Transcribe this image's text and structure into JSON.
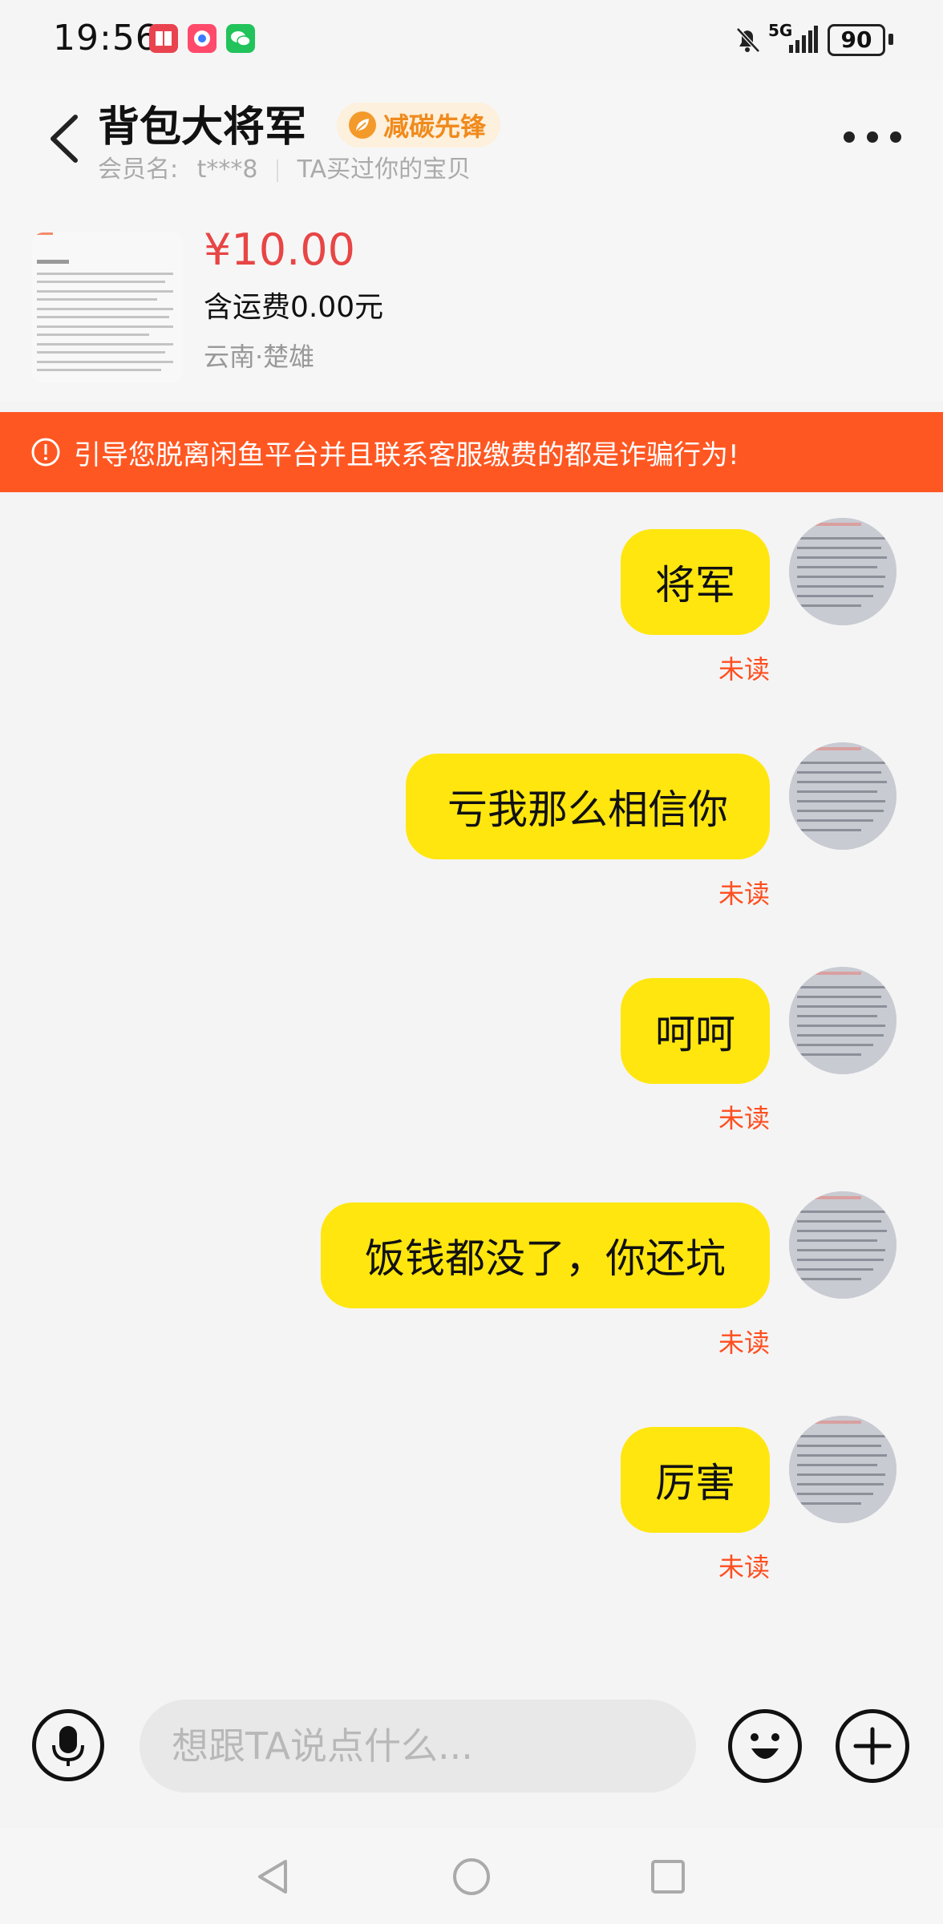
{
  "status_bar": {
    "time": "19:56",
    "network": "5G",
    "battery": "90",
    "icons": [
      "book-app-icon",
      "game-app-icon",
      "wechat-icon",
      "mute-bell-icon",
      "signal-icon",
      "battery-icon"
    ]
  },
  "header": {
    "title": "背包大将军",
    "badge": "减碳先锋",
    "member_label": "会员名:",
    "member_name": "t***8",
    "purchase_note": "TA买过你的宝贝"
  },
  "product": {
    "price": "¥10.00",
    "shipping": "含运费0.00元",
    "location": "云南·楚雄"
  },
  "warning": {
    "text": "引导您脱离闲鱼平台并且联系客服缴费的都是诈骗行为!"
  },
  "messages": [
    {
      "text": "将军",
      "status": "未读"
    },
    {
      "text": "亏我那么相信你",
      "status": "未读"
    },
    {
      "text": "呵呵",
      "status": "未读"
    },
    {
      "text": "饭钱都没了，你还坑",
      "status": "未读"
    },
    {
      "text": "厉害",
      "status": "未读"
    }
  ],
  "input": {
    "placeholder": "想跟TA说点什么..."
  },
  "colors": {
    "bubble": "#ffe60f",
    "warning_bg": "#ff5722",
    "price": "#e84545",
    "unread": "#ff4e1f",
    "badge_text": "#f08a1c"
  }
}
